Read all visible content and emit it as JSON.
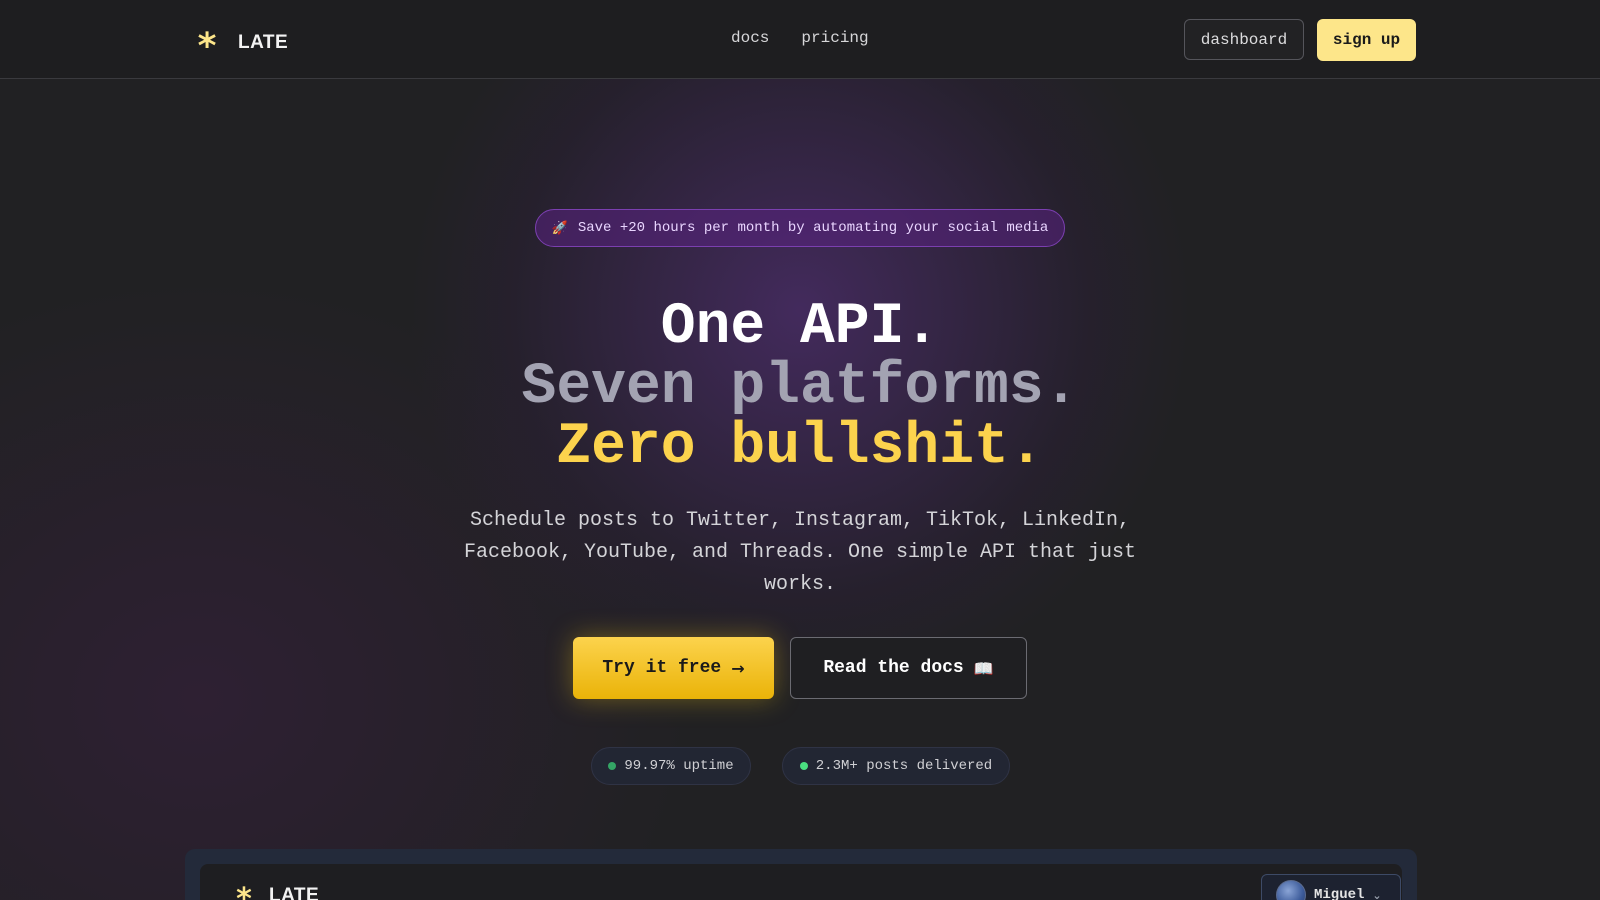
{
  "nav": {
    "brand": "LATE",
    "links": [
      "docs",
      "pricing"
    ],
    "dashboard_label": "dashboard",
    "signup_label": "sign up"
  },
  "hero": {
    "badge_icon": "🚀",
    "badge_text": "Save +20 hours per month by automating your social media",
    "headline": {
      "line1": "One API.",
      "line2": "Seven platforms.",
      "line3": "Zero bullshit."
    },
    "subtitle": "Schedule posts to Twitter, Instagram, TikTok, LinkedIn, Facebook, YouTube, and Threads. One simple API that just works.",
    "primary_cta": {
      "label": "Try it free",
      "icon": "→"
    },
    "secondary_cta": {
      "label": "Read the docs",
      "icon": "📖"
    },
    "stats": [
      {
        "label": "99.97% uptime"
      },
      {
        "label": "2.3M+ posts delivered"
      }
    ]
  },
  "preview": {
    "brand": "LATE",
    "user_name": "Miguel",
    "chevron": "⌄"
  },
  "colors": {
    "accent_yellow": "#fcd34d",
    "signup_bg": "#fde68a",
    "badge_purple": "#7b3fb0",
    "status_green": "#4ade80",
    "background": "#212123"
  },
  "icons": {
    "logo": "asterisk-icon",
    "badge": "rocket-icon",
    "primary_cta": "arrow-right-icon",
    "secondary_cta": "book-icon",
    "stat": "status-dot-icon",
    "user_menu": "chevron-down-icon"
  }
}
